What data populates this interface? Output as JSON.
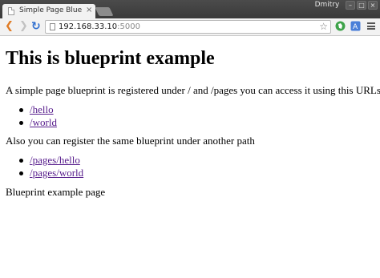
{
  "browser": {
    "tab": {
      "title": "Simple Page Blueprint",
      "close_glyph": "×",
      "favicon": "page-icon"
    },
    "user": "Dmitry",
    "window_controls": {
      "minimize": "–",
      "maximize": "□",
      "close": "×"
    },
    "toolbar": {
      "back_glyph": "❮",
      "forward_glyph": "❯",
      "reload_glyph": "↻",
      "url_host": "192.168.33.10",
      "url_port": ":5000",
      "star_glyph": "☆",
      "extensions": [
        "evernote-icon",
        "translate-icon"
      ]
    }
  },
  "page": {
    "title": "This is blueprint example",
    "intro": "A simple page blueprint is registered under / and /pages you can access it using this URLs:",
    "links_root": [
      "/hello",
      "/world"
    ],
    "middle": "Also you can register the same blueprint under another path",
    "links_pages": [
      "/pages/hello",
      "/pages/world"
    ],
    "footer": "Blueprint example page"
  },
  "colors": {
    "titlebar": "#3f3f3f",
    "toolbar": "#f2f2f2",
    "visited_link": "#551a8b",
    "back_arrow": "#e07b24",
    "reload": "#2f6fd0"
  }
}
